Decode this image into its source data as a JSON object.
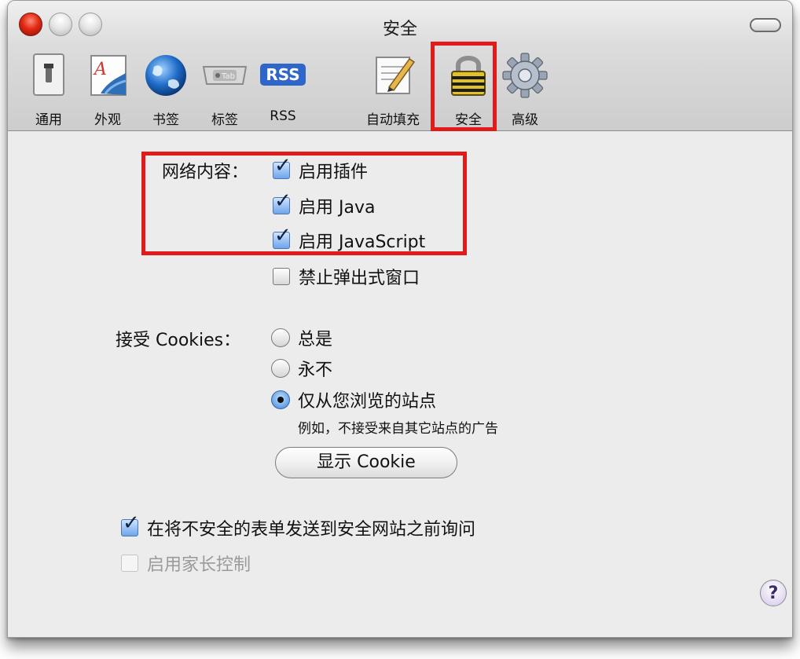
{
  "window": {
    "title": "安全"
  },
  "toolbar": {
    "items": [
      {
        "label": "通用",
        "icon": "switch-icon"
      },
      {
        "label": "外观",
        "icon": "appearance-icon"
      },
      {
        "label": "书签",
        "icon": "globe-icon"
      },
      {
        "label": "标签",
        "icon": "tab-icon",
        "icon_text": "Tab"
      },
      {
        "label": "RSS",
        "icon": "rss-icon",
        "icon_text": "RSS"
      },
      {
        "label": "自动填充",
        "icon": "pencil-form-icon"
      },
      {
        "label": "安全",
        "icon": "lock-icon",
        "selected": true
      },
      {
        "label": "高级",
        "icon": "gear-icon"
      }
    ]
  },
  "web_content": {
    "label": "网络内容：",
    "enable_plugins": {
      "label": "启用插件",
      "checked": true
    },
    "enable_java": {
      "label": "启用 Java",
      "checked": true
    },
    "enable_javascript": {
      "label": "启用 JavaScript",
      "checked": true
    },
    "block_popups": {
      "label": "禁止弹出式窗口",
      "checked": false
    }
  },
  "cookies": {
    "label": "接受 Cookies：",
    "options": [
      "总是",
      "永不",
      "仅从您浏览的站点"
    ],
    "selected_index": 2,
    "hint": "例如，不接受来自其它站点的广告",
    "show_button": "显示 Cookie"
  },
  "ask_before_sending": {
    "label": "在将不安全的表单发送到安全网站之前询问",
    "checked": true
  },
  "parental_controls": {
    "label": "启用家长控制",
    "checked": false,
    "enabled": false
  },
  "help": {
    "label": "?"
  },
  "colors": {
    "highlight": "#e11a1a",
    "accent": "#3f86d8"
  }
}
